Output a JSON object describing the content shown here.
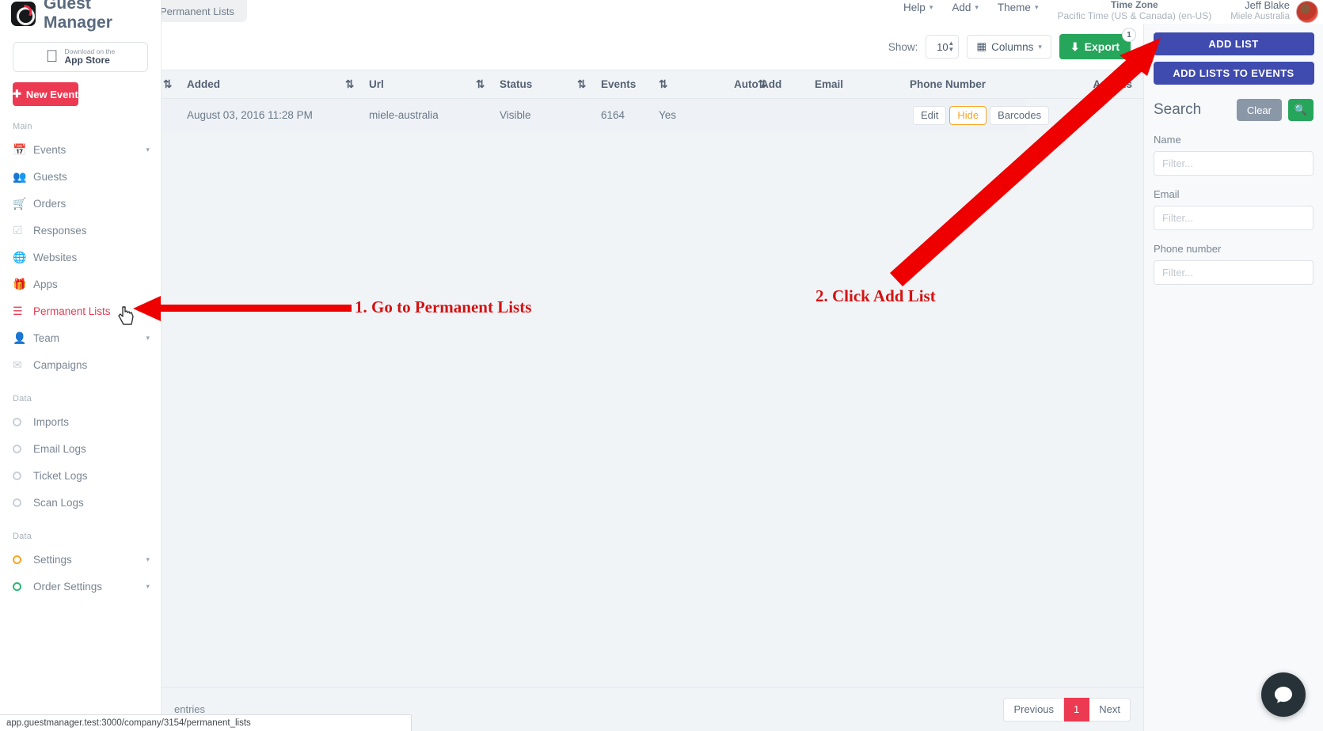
{
  "brand": {
    "name": "Guest Manager"
  },
  "appstore": {
    "line1": "Download on the",
    "line2": "App Store"
  },
  "new_event": {
    "label": "New Event",
    "plus": "✚"
  },
  "sidebar": {
    "sections": [
      {
        "title": "Main",
        "items": [
          {
            "label": "Events",
            "icon": "calendar-icon",
            "caret": "▾",
            "active": false
          },
          {
            "label": "Guests",
            "icon": "users-icon",
            "caret": "",
            "active": false
          },
          {
            "label": "Orders",
            "icon": "cart-icon",
            "caret": "",
            "active": false
          },
          {
            "label": "Responses",
            "icon": "check-square-icon",
            "caret": "",
            "active": false
          },
          {
            "label": "Websites",
            "icon": "globe-icon",
            "caret": "",
            "active": false
          },
          {
            "label": "Apps",
            "icon": "gift-icon",
            "caret": "",
            "active": false
          },
          {
            "label": "Permanent Lists",
            "icon": "ordered-list-icon",
            "caret": "",
            "active": true
          },
          {
            "label": "Team",
            "icon": "person-icon",
            "caret": "▾",
            "active": false
          },
          {
            "label": "Campaigns",
            "icon": "envelope-icon",
            "caret": "",
            "active": false
          }
        ]
      },
      {
        "title": "Data",
        "items": [
          {
            "label": "Imports",
            "icon": "ring-icon",
            "caret": "",
            "active": false
          },
          {
            "label": "Email Logs",
            "icon": "ring-icon",
            "caret": "",
            "active": false
          },
          {
            "label": "Ticket Logs",
            "icon": "ring-icon",
            "caret": "",
            "active": false
          },
          {
            "label": "Scan Logs",
            "icon": "ring-icon",
            "caret": "",
            "active": false
          }
        ]
      },
      {
        "title": "Data",
        "items": [
          {
            "label": "Settings",
            "icon": "ring-orange-icon",
            "caret": "▾",
            "active": false
          },
          {
            "label": "Order Settings",
            "icon": "ring-green-icon",
            "caret": "▾",
            "active": false
          }
        ]
      }
    ]
  },
  "topbar": {
    "tab_label": "Permanent Lists",
    "help": "Help",
    "add": "Add",
    "theme": "Theme",
    "caret": "▾",
    "timezone_title": "Time Zone",
    "timezone_value": "Pacific Time (US & Canada) (en-US)",
    "user_name": "Jeff Blake",
    "user_org": "Miele Australia"
  },
  "toolbar": {
    "show_label": "Show:",
    "show_value": "10",
    "columns_label": "Columns",
    "columns_icon": "grid-icon",
    "columns_caret": "▾",
    "export_label": "Export",
    "export_icon": "download-icon",
    "export_badge": "1"
  },
  "table": {
    "columns": [
      "Added",
      "Url",
      "Status",
      "Events",
      "Auto Add",
      "Email",
      "Phone Number",
      "Actions"
    ],
    "sort_icon": "sort-updown-icon",
    "rows": [
      {
        "added": "August 03, 2016 11:28 PM",
        "url": "miele-australia",
        "status": "Visible",
        "events": "6164",
        "auto_add": "Yes",
        "email": "",
        "phone": "",
        "actions": [
          "Edit",
          "Hide",
          "Barcodes"
        ]
      }
    ]
  },
  "footer": {
    "entries_text": "entries",
    "pagination": {
      "previous": "Previous",
      "current": "1",
      "next": "Next"
    }
  },
  "right_panel": {
    "add_list": "ADD LIST",
    "add_lists_to_events": "ADD LISTS TO EVENTS",
    "search_title": "Search",
    "clear_label": "Clear",
    "search_icon": "magnifier-icon",
    "fields": [
      {
        "label": "Name",
        "value": "",
        "placeholder": "Filter..."
      },
      {
        "label": "Email",
        "value": "",
        "placeholder": "Filter..."
      },
      {
        "label": "Phone number",
        "value": "",
        "placeholder": "Filter..."
      }
    ]
  },
  "annotations": {
    "step1": "1. Go to Permanent Lists",
    "step2": "2. Click Add List",
    "arrow_color": "#ee0000"
  },
  "statusbar": {
    "url": "app.guestmanager.test:3000/company/3154/permanent_lists"
  },
  "intercom": {
    "icon": "chat-icon"
  }
}
